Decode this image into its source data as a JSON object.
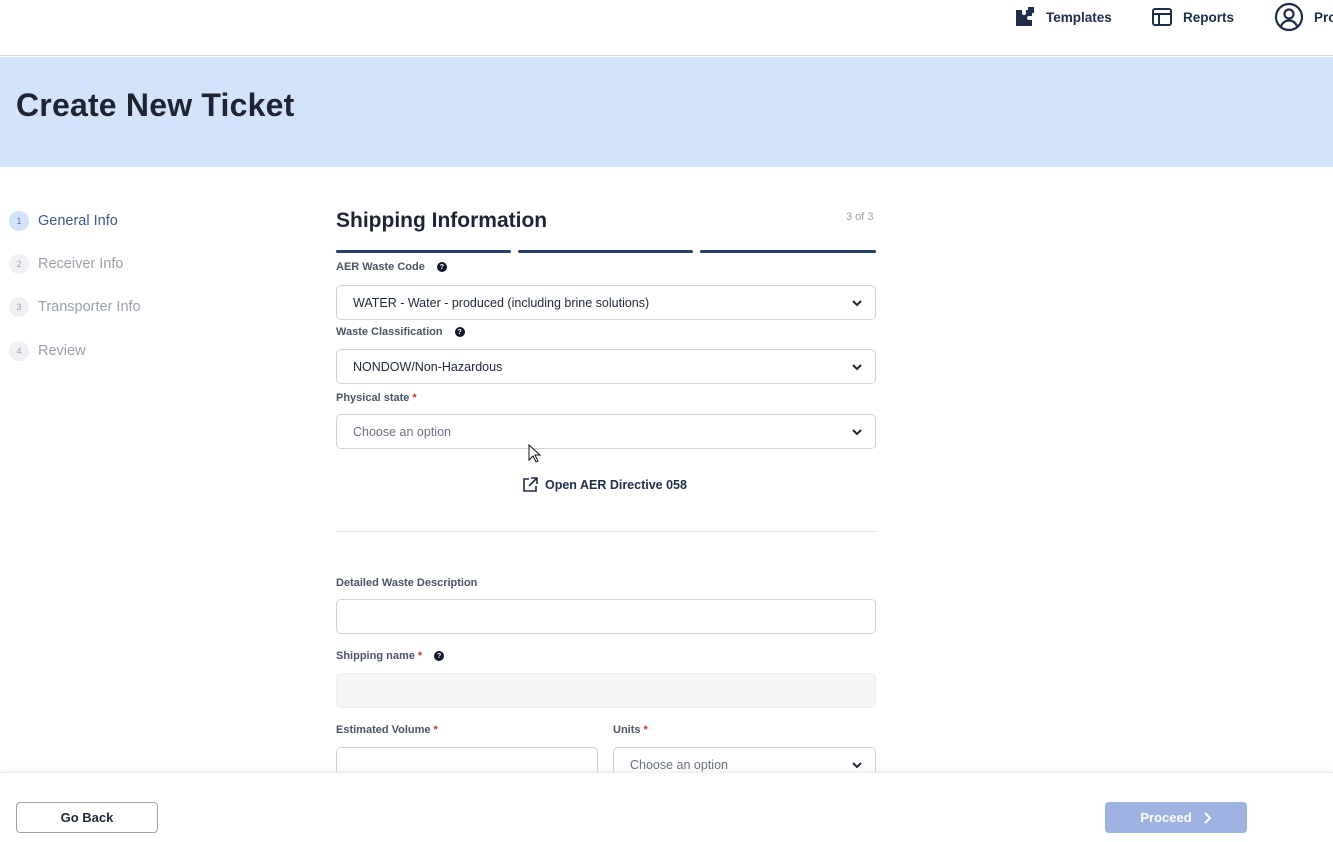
{
  "nav": {
    "templates": "Templates",
    "reports": "Reports",
    "profile": "Pro"
  },
  "header": {
    "title": "Create New Ticket"
  },
  "steps": [
    {
      "num": "1",
      "label": "General Info"
    },
    {
      "num": "2",
      "label": "Receiver Info"
    },
    {
      "num": "3",
      "label": "Transporter Info"
    },
    {
      "num": "4",
      "label": "Review"
    }
  ],
  "form": {
    "title": "Shipping Information",
    "step_count": "3 of 3",
    "aer_waste_code": {
      "label": "AER Waste Code",
      "value": "WATER - Water - produced (including brine solutions)"
    },
    "waste_classification": {
      "label": "Waste Classification",
      "value": "NONDOW/Non-Hazardous"
    },
    "physical_state": {
      "label": "Physical state",
      "placeholder": "Choose an option"
    },
    "aer_link": "Open AER Directive 058",
    "detailed_description": {
      "label": "Detailed Waste Description",
      "value": ""
    },
    "shipping_name": {
      "label": "Shipping name",
      "value": ""
    },
    "estimated_volume": {
      "label": "Estimated Volume",
      "value": ""
    },
    "units": {
      "label": "Units",
      "placeholder": "Choose an option"
    },
    "required_mark": "*",
    "help_mark": "?"
  },
  "footer": {
    "back": "Go Back",
    "proceed": "Proceed"
  },
  "colors": {
    "header_band": "#d3e3fa",
    "progress": "#27416b",
    "proceed_disabled": "#9fb3e3"
  }
}
